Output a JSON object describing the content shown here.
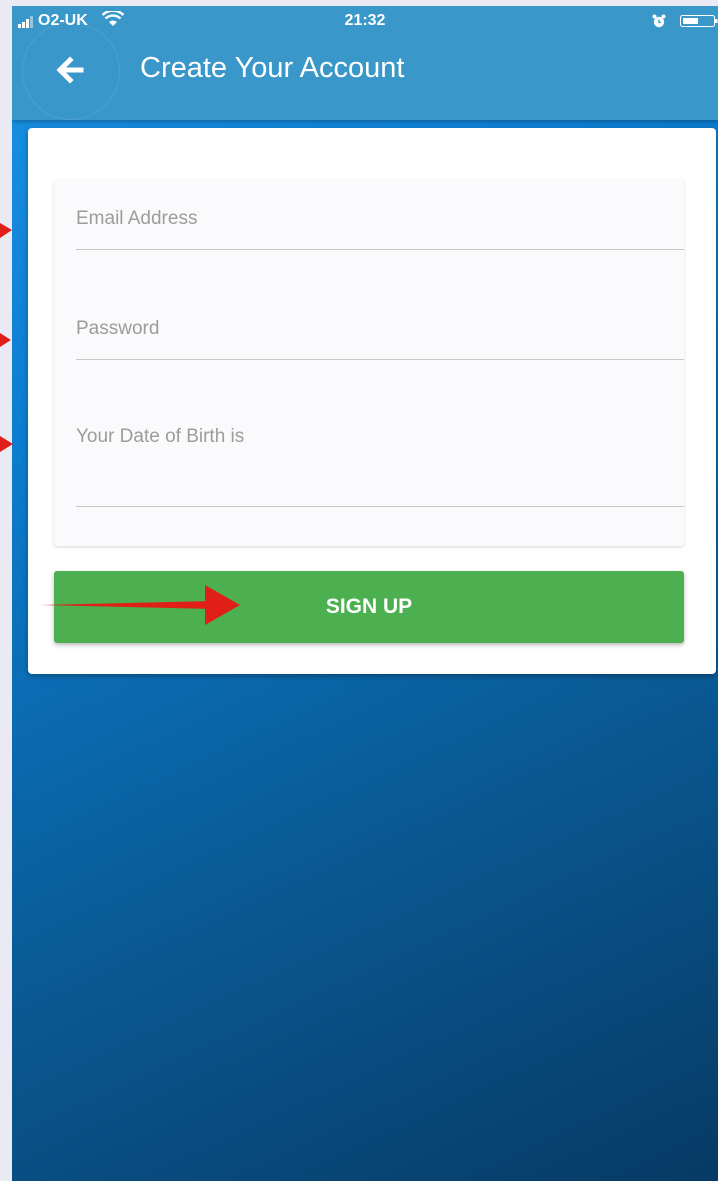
{
  "status_bar": {
    "carrier": "O2-UK",
    "time": "21:32",
    "signal_icon": "signal-bars-icon",
    "wifi_icon": "wifi-icon",
    "alarm_icon": "alarm-icon",
    "battery_icon": "battery-icon"
  },
  "header": {
    "title": "Create Your Account",
    "back_icon": "arrow-left-icon"
  },
  "form": {
    "email_placeholder": "Email Address",
    "password_placeholder": "Password",
    "dob_placeholder": "Your Date of Birth is"
  },
  "signup_button": {
    "label": "SIGN UP"
  },
  "colors": {
    "app_bar": "#3a97c9",
    "background_gradient_start": "#1a93e6",
    "background_gradient_end": "#073a64",
    "signup_button": "#4caf50",
    "annotation_arrow": "#e02018"
  }
}
